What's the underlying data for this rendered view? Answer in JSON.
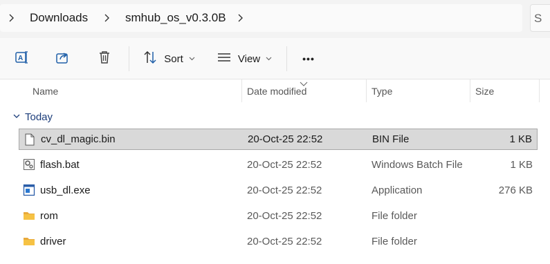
{
  "breadcrumb": {
    "items": [
      {
        "label": "Downloads"
      },
      {
        "label": "smhub_os_v0.3.0B"
      }
    ],
    "search_partial": "S"
  },
  "toolbar": {
    "rename_icon": "rename-icon",
    "share_icon": "share-icon",
    "delete_icon": "trash-icon",
    "sort_label": "Sort",
    "view_label": "View",
    "more_label": "•••"
  },
  "columns": {
    "name": "Name",
    "date": "Date modified",
    "type": "Type",
    "size": "Size"
  },
  "group": {
    "label": "Today"
  },
  "files": [
    {
      "name": "cv_dl_magic.bin",
      "date": "20-Oct-25 22:52",
      "type": "BIN File",
      "size": "1 KB",
      "icon": "file-icon",
      "selected": true
    },
    {
      "name": "flash.bat",
      "date": "20-Oct-25 22:52",
      "type": "Windows Batch File",
      "size": "1 KB",
      "icon": "batch-file-icon",
      "selected": false
    },
    {
      "name": "usb_dl.exe",
      "date": "20-Oct-25 22:52",
      "type": "Application",
      "size": "276 KB",
      "icon": "application-icon",
      "selected": false
    },
    {
      "name": "rom",
      "date": "20-Oct-25 22:52",
      "type": "File folder",
      "size": "",
      "icon": "folder-icon",
      "selected": false
    },
    {
      "name": "driver",
      "date": "20-Oct-25 22:52",
      "type": "File folder",
      "size": "",
      "icon": "folder-icon",
      "selected": false
    }
  ],
  "colors": {
    "accent": "#1c3d7a",
    "toolbar_icon": "#1f5fa8",
    "folder": "#f6c244",
    "selection": "#d9d9d9"
  }
}
